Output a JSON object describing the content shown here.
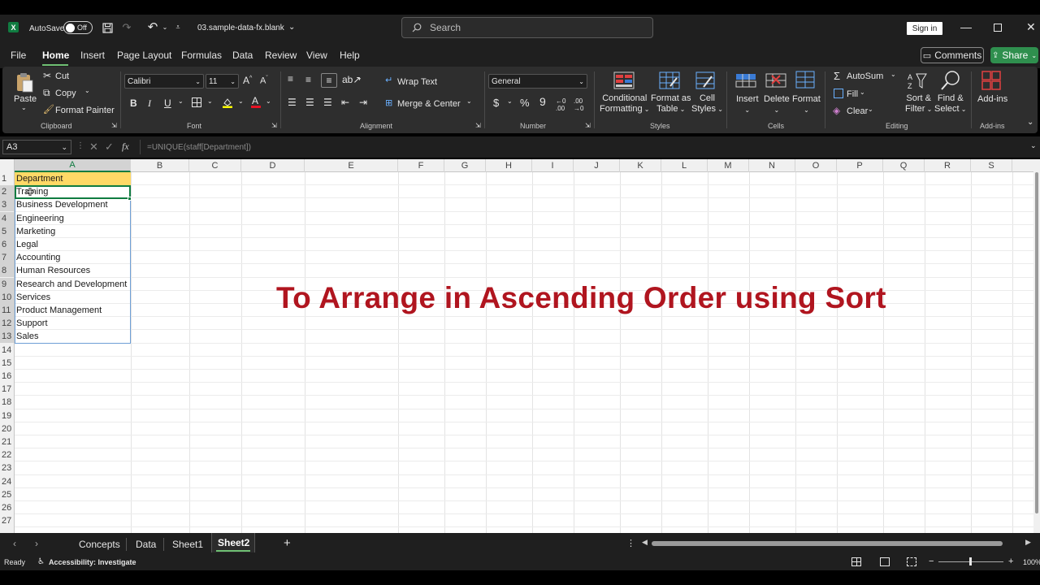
{
  "titlebar": {
    "autosave_label": "AutoSave",
    "autosave_state": "Off",
    "filename": "03.sample-data-fx.blank",
    "search_placeholder": "Search",
    "signin_label": "Sign in"
  },
  "menu": {
    "tabs": [
      "File",
      "Home",
      "Insert",
      "Page Layout",
      "Formulas",
      "Data",
      "Review",
      "View",
      "Help"
    ],
    "comments_label": "Comments",
    "share_label": "Share"
  },
  "ribbon": {
    "clipboard": {
      "paste": "Paste",
      "cut": "Cut",
      "copy": "Copy",
      "format_painter": "Format Painter",
      "group": "Clipboard"
    },
    "font": {
      "family": "Calibri",
      "size": "11",
      "group": "Font"
    },
    "alignment": {
      "wrap_text": "Wrap Text",
      "merge_center": "Merge & Center",
      "group": "Alignment"
    },
    "number": {
      "format": "General",
      "group": "Number"
    },
    "styles": {
      "conditional_1": "Conditional",
      "conditional_2": "Formatting",
      "format_table_1": "Format as",
      "format_table_2": "Table",
      "cell_styles_1": "Cell",
      "cell_styles_2": "Styles",
      "group": "Styles"
    },
    "cells": {
      "insert": "Insert",
      "delete": "Delete",
      "format": "Format",
      "group": "Cells"
    },
    "editing": {
      "autosum": "AutoSum",
      "fill": "Fill",
      "clear": "Clear",
      "sort_1": "Sort &",
      "sort_2": "Filter",
      "find_1": "Find &",
      "find_2": "Select",
      "group": "Editing"
    },
    "addins": {
      "label": "Add-ins",
      "group": "Add-ins"
    }
  },
  "formula_bar": {
    "name_box": "A3",
    "formula": "=UNIQUE(staff[Department])"
  },
  "columns": [
    "A",
    "B",
    "C",
    "D",
    "E",
    "F",
    "G",
    "H",
    "I",
    "J",
    "K",
    "L",
    "M",
    "N",
    "O",
    "P",
    "Q",
    "R",
    "S"
  ],
  "rows": [
    "1",
    "2",
    "3",
    "4",
    "5",
    "6",
    "7",
    "8",
    "9",
    "10",
    "11",
    "12",
    "13",
    "14",
    "15",
    "16",
    "17",
    "18",
    "19",
    "20",
    "21",
    "22",
    "23",
    "24",
    "25",
    "26",
    "27"
  ],
  "cells_a": [
    "Department",
    "Training",
    "Business Development",
    "Engineering",
    "Marketing",
    "Legal",
    "Accounting",
    "Human Resources",
    "Research and Development",
    "Services",
    "Product Management",
    "Support",
    "Sales"
  ],
  "overlay_text": "To Arrange in Ascending Order using Sort",
  "sheet_tabs": [
    "Concepts",
    "Data",
    "Sheet1",
    "Sheet2"
  ],
  "status": {
    "ready": "Ready",
    "accessibility": "Accessibility: Investigate",
    "zoom": "100%"
  },
  "colors": {
    "accent_green": "#107c41",
    "overlay_red": "#b0151f",
    "header_yellow": "#ffd966"
  }
}
